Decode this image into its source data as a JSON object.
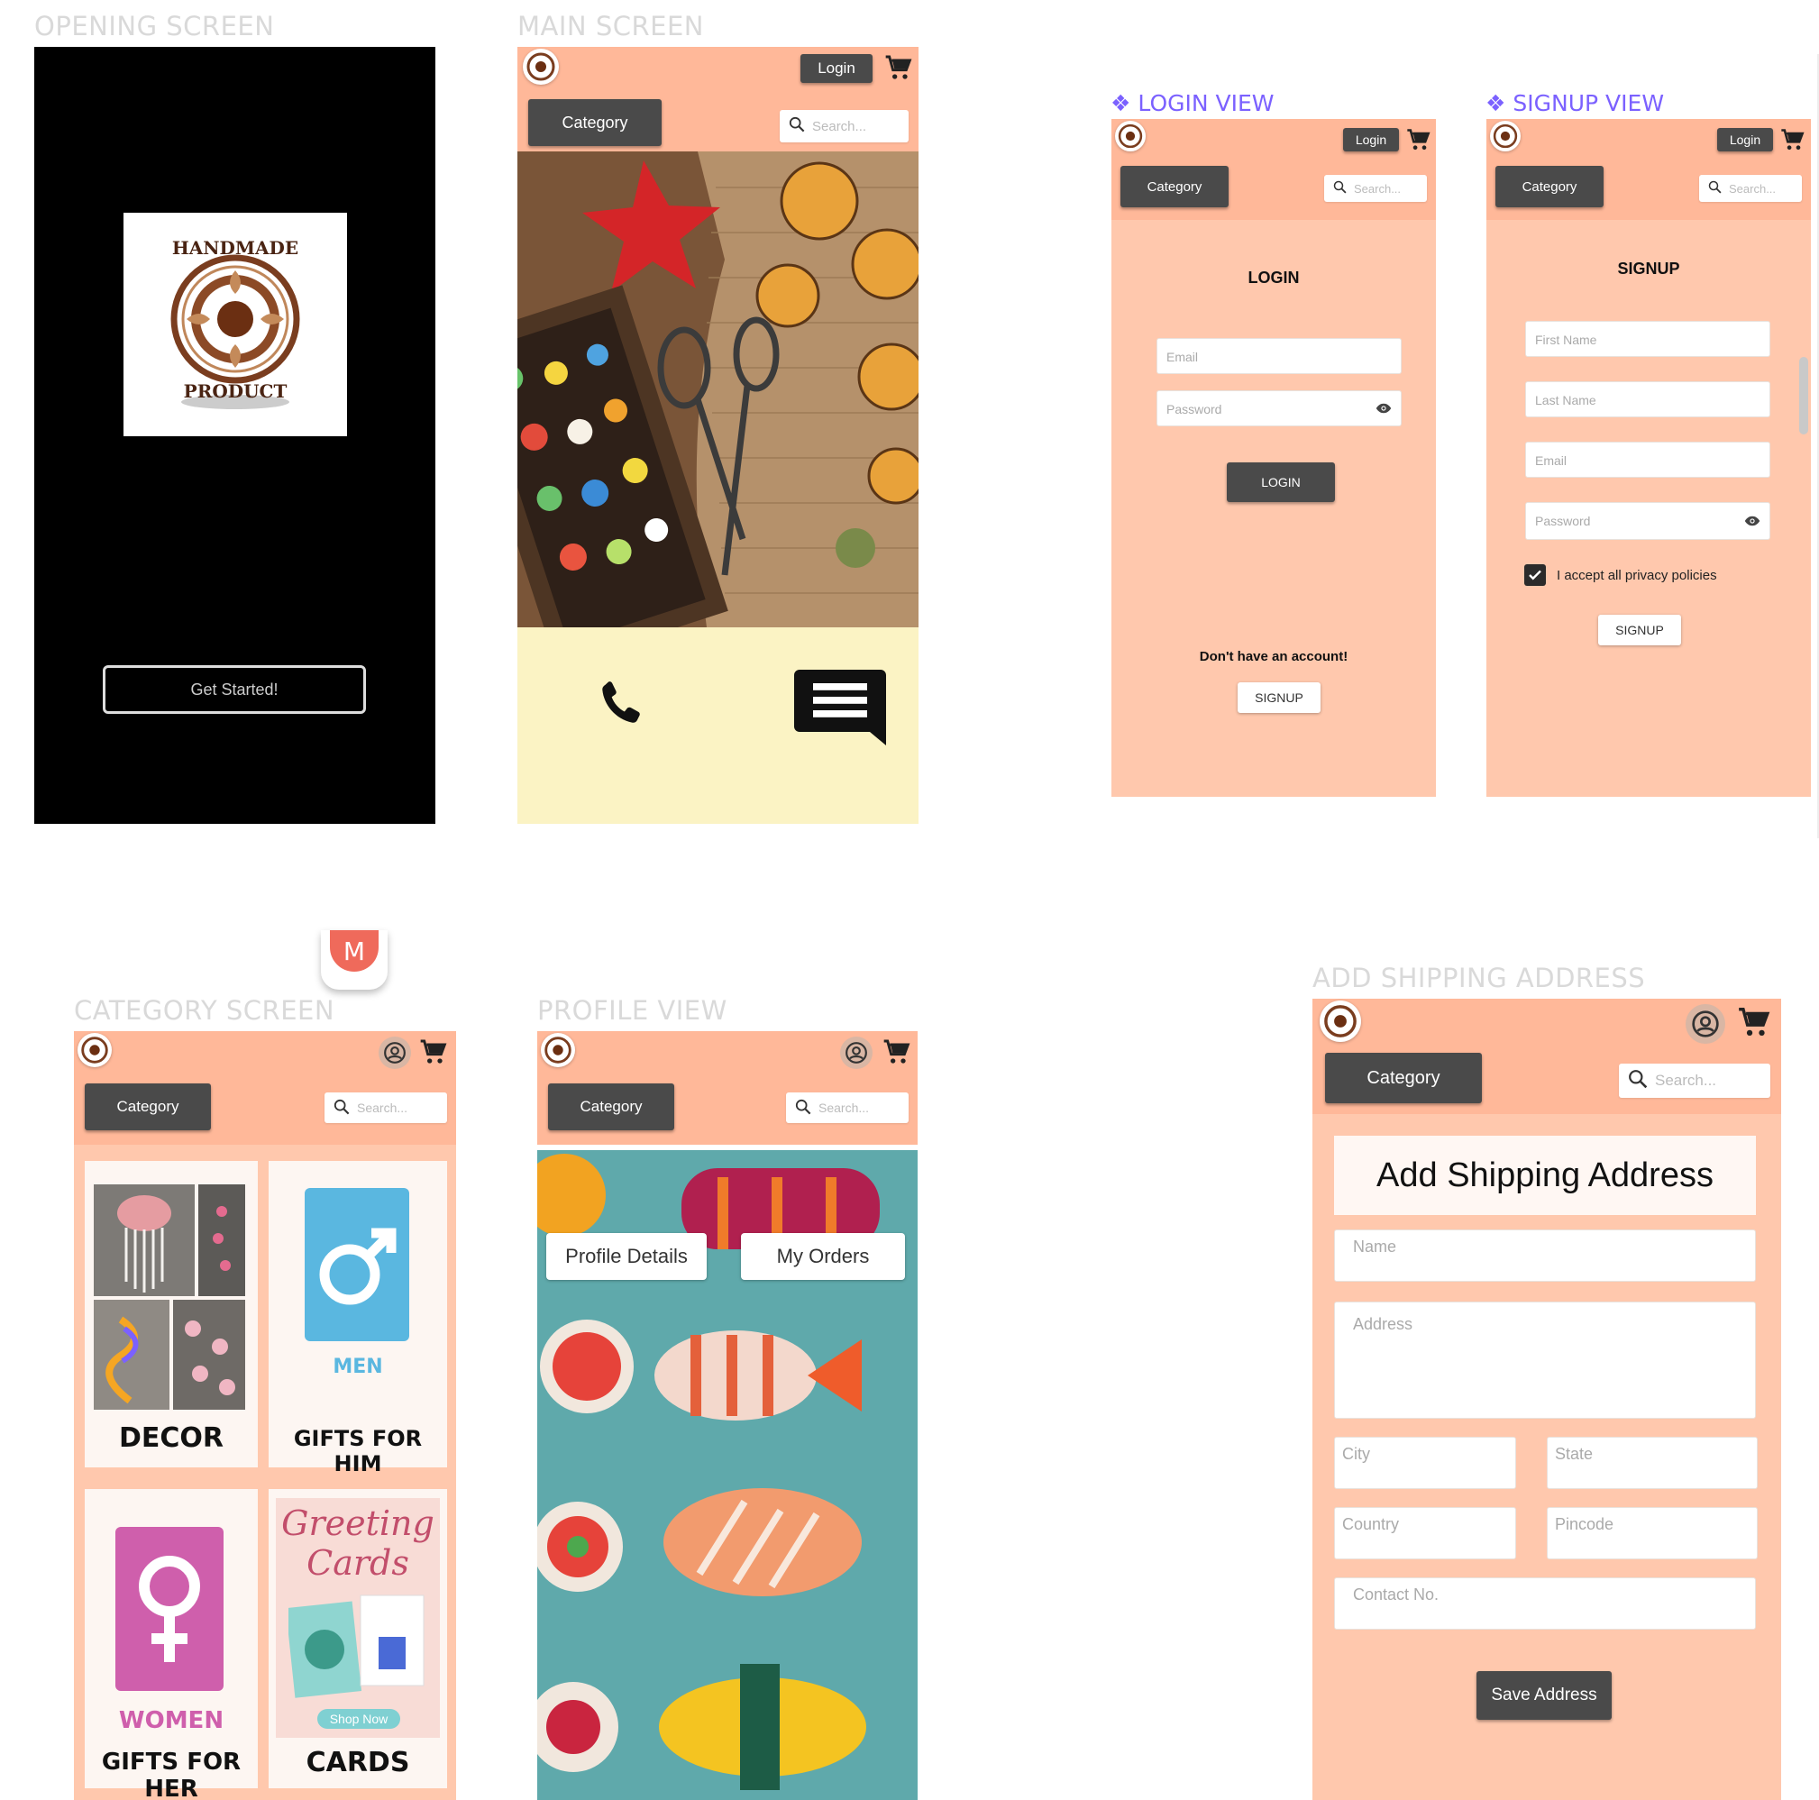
{
  "labels": {
    "opening": "OPENING SCREEN",
    "main": "MAIN SCREEN",
    "login_view": "LOGIN VIEW",
    "signup_view": "SIGNUP VIEW",
    "category": "CATEGORY SCREEN",
    "profile": "PROFILE VIEW",
    "shipping": "ADD SHIPPING ADDRESS",
    "diamond": "❖"
  },
  "opening": {
    "logo_top": "HANDMADE",
    "logo_bottom": "PRODUCT",
    "get_started": "Get Started!"
  },
  "common": {
    "login_button": "Login",
    "category_button": "Category",
    "search_placeholder": "Search...",
    "magnifier": "⚲"
  },
  "main": {
    "phone_icon": "phone-icon",
    "message_icon": "message-icon"
  },
  "login": {
    "title": "LOGIN",
    "email_placeholder": "Email",
    "password_placeholder": "Password",
    "login_button": "LOGIN",
    "no_account": "Don't have an account!",
    "signup_button": "SIGNUP"
  },
  "signup": {
    "title": "SIGNUP",
    "first_name": "First Name",
    "last_name": "Last Name",
    "email": "Email",
    "password": "Password",
    "policy": "I accept all privacy policies",
    "policy_checked": true,
    "signup_button": "SIGNUP"
  },
  "avatar_letter": "M",
  "category": {
    "tiles": [
      {
        "label": "DECOR"
      },
      {
        "label": "GIFTS FOR HIM",
        "badge": "MEN"
      },
      {
        "label": "GIFTS FOR HER",
        "badge": "WOMEN"
      },
      {
        "label": "CARDS",
        "art_line1": "Greeting",
        "art_line2": "Cards",
        "art_button": "Shop Now"
      }
    ]
  },
  "profile": {
    "tab_profile": "Profile Details",
    "tab_orders": "My Orders"
  },
  "shipping": {
    "title": "Add Shipping Address",
    "name": "Name",
    "address": "Address",
    "city": "City",
    "state": "State",
    "country": "Country",
    "pincode": "Pincode",
    "contact": "Contact No.",
    "save": "Save Address"
  },
  "colors": {
    "header": "#ffb899",
    "body_peach": "#ffc8ad",
    "main_footer": "#fbf3c4",
    "dark_button": "#4a4a4a",
    "accent_label": "#7b61ff",
    "profile_bg": "#5fa9ab"
  }
}
